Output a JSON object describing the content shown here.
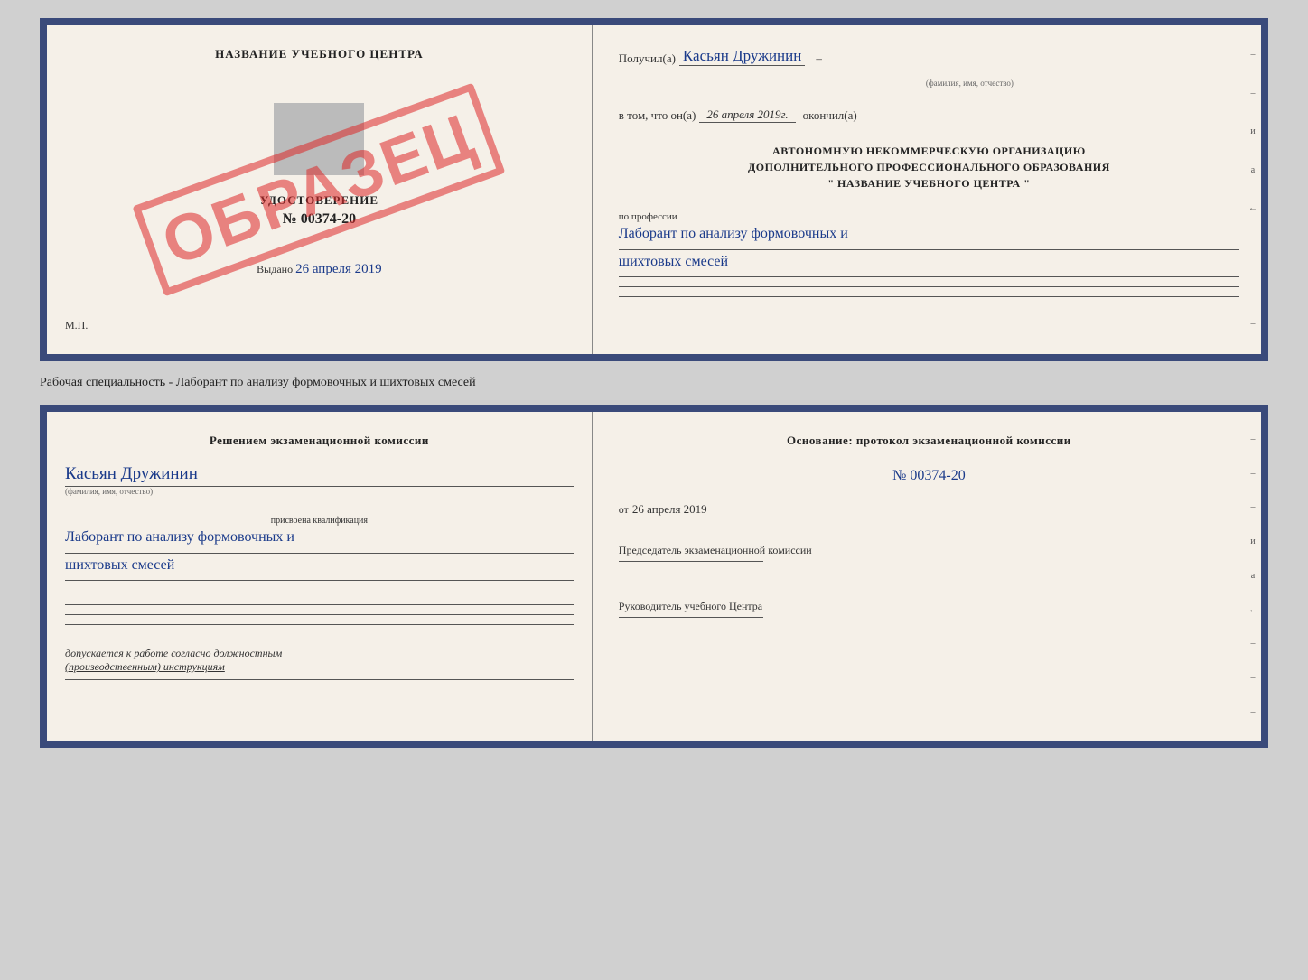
{
  "topDoc": {
    "leftPanel": {
      "title": "НАЗВАНИЕ УЧЕБНОГО ЦЕНТРА",
      "certificateLabel": "УДОСТОВЕРЕНИЕ",
      "certificateNumber": "№ 00374-20",
      "stamp": "ОБРАЗЕЦ",
      "issuedText": "Выдано",
      "issuedDate": "26 апреля 2019",
      "mpLabel": "М.П."
    },
    "rightPanel": {
      "receivedLabel": "Получил(а)",
      "recipientName": "Касьян Дружинин",
      "nameSubLabel": "(фамилия, имя, отчество)",
      "inThatLabel": "в том, что он(а)",
      "completedDate": "26 апреля 2019г.",
      "completedLabel": "окончил(а)",
      "orgLine1": "АВТОНОМНУЮ НЕКОММЕРЧЕСКУЮ ОРГАНИЗАЦИЮ",
      "orgLine2": "ДОПОЛНИТЕЛЬНОГО ПРОФЕССИОНАЛЬНОГО ОБРАЗОВАНИЯ",
      "orgLine3": "\"    НАЗВАНИЕ УЧЕБНОГО ЦЕНТРА    \"",
      "professionLabel": "по профессии",
      "professionText": "Лаборант по анализу формовочных и",
      "professionText2": "шихтовых смесей"
    }
  },
  "middleText": "Рабочая специальность - Лаборант по анализу формовочных и шихтовых смесей",
  "bottomDoc": {
    "leftPanel": {
      "commissionText": "Решением экзаменационной комиссии",
      "name": "Касьян Дружинин",
      "nameSubLabel": "(фамилия, имя, отчество)",
      "qualificationLabel": "присвоена квалификация",
      "qualificationText": "Лаборант по анализу формовочных и",
      "qualificationText2": "шихтовых смесей",
      "admissionLabel": "допускается к",
      "admissionText": "работе согласно должностным",
      "admissionText2": "(производственным) инструкциям"
    },
    "rightPanel": {
      "basisLabel": "Основание: протокол экзаменационной комиссии",
      "protocolNumber": "№ 00374-20",
      "fromLabel": "от",
      "fromDate": "26 апреля 2019",
      "chairmanLabel": "Председатель экзаменационной комиссии",
      "directorLabel": "Руководитель учебного Центра"
    }
  }
}
